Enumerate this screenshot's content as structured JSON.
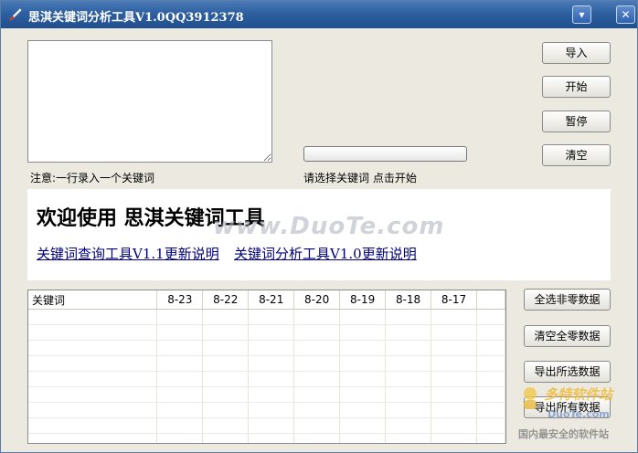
{
  "window": {
    "title": "思淇关键词分析工具V1.0QQ3912378",
    "minimize_glyph": "▾",
    "close_glyph": "✕"
  },
  "input": {
    "hint": "注意:一行录入一个关键词"
  },
  "status": {
    "hint": "请选择关键词 点击开始",
    "progress": 0
  },
  "buttons": {
    "import": "导入",
    "start": "开始",
    "pause": "暂停",
    "clear": "清空",
    "select_nonzero": "全选非零数据",
    "clear_zero": "清空全零数据",
    "export_selected": "导出所选数据",
    "export_all": "导出所有数据"
  },
  "welcome": {
    "title": "欢迎使用  思淇关键词工具",
    "link1": "关键词查询工具V1.1更新说明",
    "link2": "关键词分析工具V1.0更新说明"
  },
  "table": {
    "columns": [
      "关键词",
      "8-23",
      "8-22",
      "8-21",
      "8-20",
      "8-19",
      "8-18",
      "8-17"
    ],
    "rows": []
  },
  "watermark": {
    "main": "www.DuoTe.com",
    "brand_cn": "多特软件站",
    "brand_url": "DuoTe.com",
    "slogan": "国内最安全的软件站"
  },
  "colors": {
    "titlebar": "#2e5f9e",
    "window_bg": "#eceae0",
    "link": "#000080"
  }
}
